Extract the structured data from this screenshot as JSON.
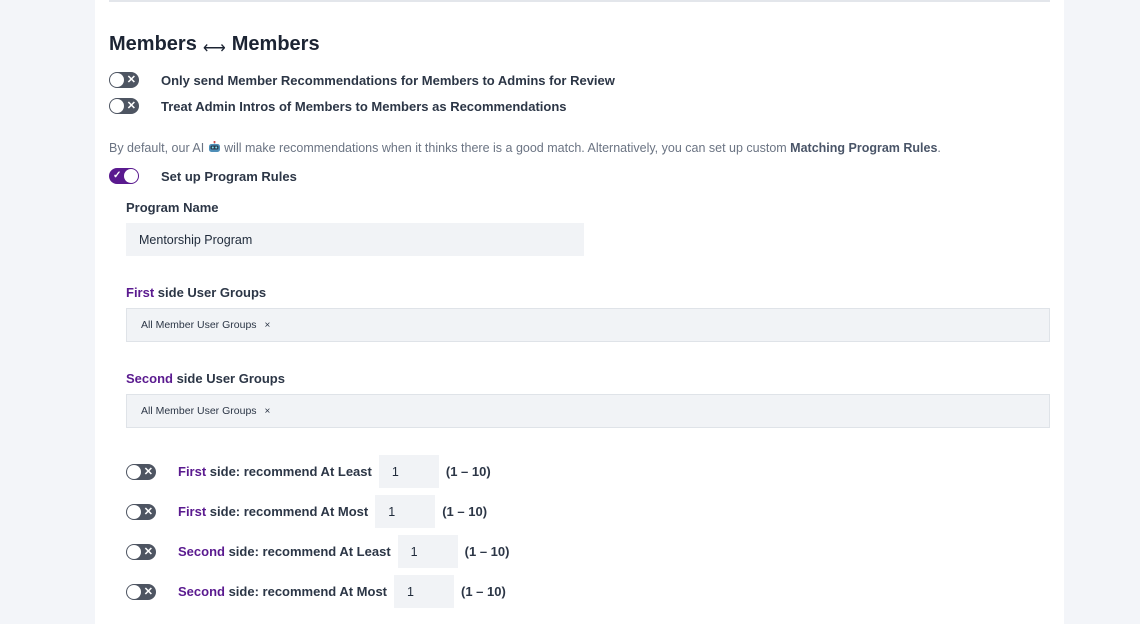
{
  "section": {
    "title_left": "Members",
    "title_arrow": "⟷",
    "title_right": "Members"
  },
  "toggles": [
    {
      "label": "Only send Member Recommendations for Members to Admins for Review",
      "on": false
    },
    {
      "label": "Treat Admin Intros of Members to Members as Recommendations",
      "on": false
    }
  ],
  "description": {
    "before": "By default, our AI ",
    "icon": "robot-icon",
    "after": " will make recommendations when it thinks there is a good match. Alternatively, you can set up custom ",
    "link": "Matching Program Rules",
    "end": "."
  },
  "program_rules": {
    "toggle_label": "Set up Program Rules",
    "on": true,
    "program_name_label": "Program Name",
    "program_name_value": "Mentorship Program",
    "first_groups_label_accent": "First",
    "first_groups_label_rest": " side User Groups",
    "first_groups_chip": "All Member User Groups",
    "second_groups_label_accent": "Second",
    "second_groups_label_rest": " side User Groups",
    "second_groups_chip": "All Member User Groups",
    "chip_remove": "×"
  },
  "limits": [
    {
      "accent": "First",
      "rest": " side: recommend At Least",
      "value": "1",
      "range": "(1 – 10)"
    },
    {
      "accent": "First",
      "rest": " side: recommend At Most",
      "value": "1",
      "range": "(1 – 10)"
    },
    {
      "accent": "Second",
      "rest": " side: recommend At Least",
      "value": "1",
      "range": "(1 – 10)"
    },
    {
      "accent": "Second",
      "rest": " side: recommend At Most",
      "value": "1",
      "range": "(1 – 10)"
    }
  ],
  "toggle_marks": {
    "off": "✕",
    "on": "✓"
  },
  "colors": {
    "accent": "#5a1a8f",
    "toggle_off": "#4e5562"
  }
}
